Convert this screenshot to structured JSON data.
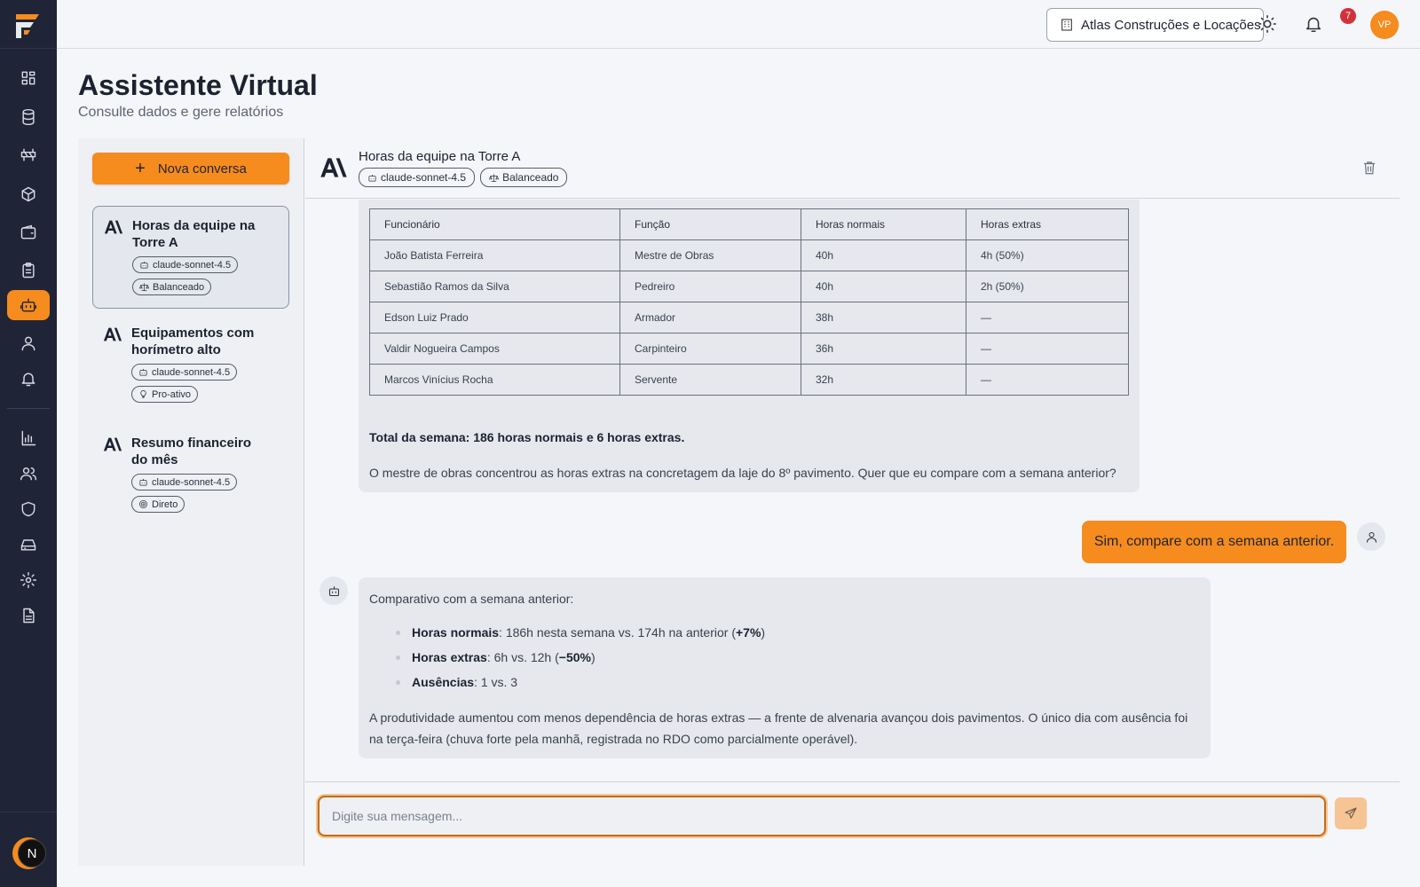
{
  "topbar": {
    "company": "Atlas Construções e Locações",
    "notifications_count": "7",
    "user_initials": "VP"
  },
  "page": {
    "title": "Assistente Virtual",
    "subtitle": "Consulte dados e gere relatórios"
  },
  "sidebar": {
    "items": [
      "dashboard",
      "database",
      "barrier",
      "cube",
      "wallet",
      "clipboard",
      "bot",
      "user",
      "bell",
      "chart",
      "users",
      "shield",
      "drive",
      "gear",
      "file"
    ],
    "active": "bot",
    "dev_badge": "N"
  },
  "conversations": {
    "new_label": "Nova conversa",
    "items": [
      {
        "title": "Horas da equipe na Torre A",
        "model": "claude-sonnet-4.5",
        "mode": "Balanceado",
        "mode_icon": "scale-icon",
        "active": true
      },
      {
        "title": "Equipamentos com horímetro alto",
        "model": "claude-sonnet-4.5",
        "mode": "Pro-ativo",
        "mode_icon": "bulb-icon",
        "active": false
      },
      {
        "title": "Resumo financeiro do mês",
        "model": "claude-sonnet-4.5",
        "mode": "Direto",
        "mode_icon": "target-icon",
        "active": false
      }
    ]
  },
  "chat": {
    "title": "Horas da equipe na Torre A",
    "model": "claude-sonnet-4.5",
    "mode": "Balanceado",
    "table": {
      "headers": [
        "Funcionário",
        "Função",
        "Horas normais",
        "Horas extras"
      ],
      "rows": [
        [
          "João Batista Ferreira",
          "Mestre de Obras",
          "40h",
          "4h (50%)"
        ],
        [
          "Sebastião Ramos da Silva",
          "Pedreiro",
          "40h",
          "2h (50%)"
        ],
        [
          "Edson Luiz Prado",
          "Armador",
          "38h",
          "—"
        ],
        [
          "Valdir Nogueira Campos",
          "Carpinteiro",
          "36h",
          "—"
        ],
        [
          "Marcos Vinícius Rocha",
          "Servente",
          "32h",
          "—"
        ]
      ]
    },
    "total": "Total da semana: 186 horas normais e 6 horas extras.",
    "followup": "O mestre de obras concentrou as horas extras na concretagem da laje do 8º pavimento. Quer que eu compare com a semana anterior?",
    "user_message": "Sim, compare com a semana anterior.",
    "reply": {
      "intro": "Comparativo com a semana anterior:",
      "bullets": [
        {
          "label": "Horas normais",
          "text": ": 186h nesta semana vs. 174h na anterior (",
          "strong": "+7%",
          "end": ")"
        },
        {
          "label": "Horas extras",
          "text": ": 6h vs. 12h (",
          "strong": "−50%",
          "end": ")"
        },
        {
          "label": "Ausências",
          "text": ": 1 vs. 3",
          "strong": "",
          "end": ""
        }
      ],
      "paragraph": "A produtividade aumentou com menos dependência de horas extras — a frente de alvenaria avançou dois pavimentos. O único dia com ausência foi na terça-feira (chuva forte pela manhã, registrada no RDO como parcialmente operável)."
    },
    "input_placeholder": "Digite sua mensagem..."
  },
  "colors": {
    "accent": "#f68b1e",
    "sidebar_bg": "#1f2536",
    "badge": "#d3313a"
  }
}
